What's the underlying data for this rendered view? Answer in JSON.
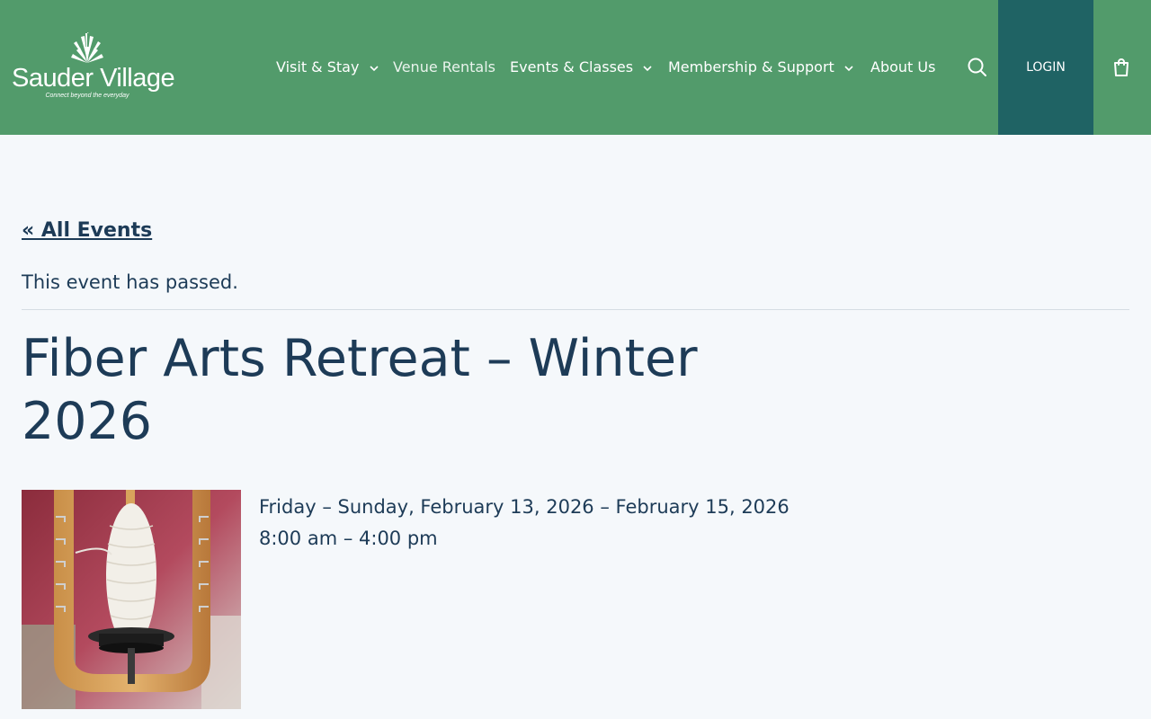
{
  "header": {
    "brand": {
      "name": "Sauder Village",
      "tagline": "Connect beyond the everyday"
    },
    "nav": [
      {
        "label": "Visit & Stay",
        "dropdown": true
      },
      {
        "label": "Venue Rentals",
        "dropdown": false
      },
      {
        "label": "Events & Classes",
        "dropdown": true
      },
      {
        "label": "Membership & Support",
        "dropdown": true
      },
      {
        "label": "About Us",
        "dropdown": false
      }
    ],
    "search_icon": "search-icon",
    "login_label": "LOGIN",
    "cart_icon": "shopping-bag-icon",
    "colors": {
      "header_bg": "#529b6b",
      "login_bg": "#1f6364"
    }
  },
  "main": {
    "back_link": "« All Events",
    "notice": "This event has passed.",
    "title": "Fiber Arts Retreat – Winter 2026",
    "dates": "Friday – Sunday, February 13, 2026 – February 15, 2026",
    "time": "8:00 am – 4:00 pm",
    "colors": {
      "text": "#1d3b57",
      "background": "#f5f8fb"
    }
  }
}
